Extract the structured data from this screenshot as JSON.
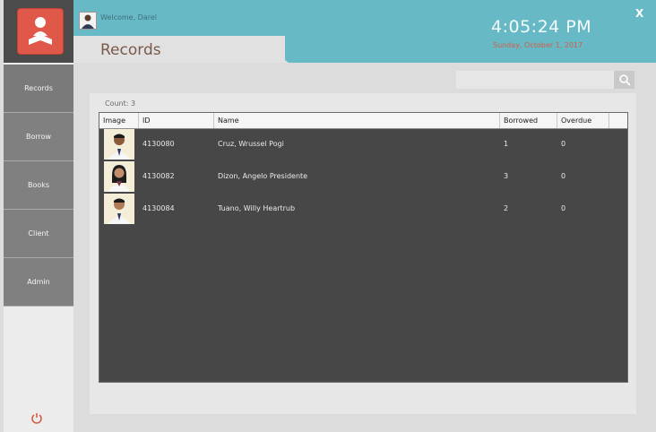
{
  "header": {
    "welcome": "Welcome, Darel",
    "title": "Records",
    "time": "4:05:24 PM",
    "date": "Sunday, October 1, 2017",
    "close": "X"
  },
  "sidebar": {
    "items": [
      {
        "label": "Records"
      },
      {
        "label": "Borrow"
      },
      {
        "label": "Books"
      },
      {
        "label": "Client"
      },
      {
        "label": "Admin"
      }
    ]
  },
  "search": {
    "placeholder": "",
    "value": ""
  },
  "records": {
    "count": "Count: 3",
    "columns": [
      "Image",
      "ID",
      "Name",
      "Borrowed",
      "Overdue"
    ],
    "rows": [
      {
        "id": "4130080",
        "name": "Cruz, Wrussel Pogi",
        "borrowed": "1",
        "overdue": "0",
        "gender": "male"
      },
      {
        "id": "4130082",
        "name": "Dizon, Angelo Presidente",
        "borrowed": "3",
        "overdue": "0",
        "gender": "female"
      },
      {
        "id": "4130084",
        "name": "Tuano, Willy Heartrub",
        "borrowed": "2",
        "overdue": "0",
        "gender": "male"
      }
    ]
  },
  "colors": {
    "accent": "#67b9c6",
    "logo": "#e0584a",
    "sidebar": "#808080",
    "grid": "#474747",
    "date": "#d35e46"
  },
  "icons": [
    "reader-logo-icon",
    "search-icon",
    "power-icon",
    "user-avatar",
    "close-icon"
  ]
}
